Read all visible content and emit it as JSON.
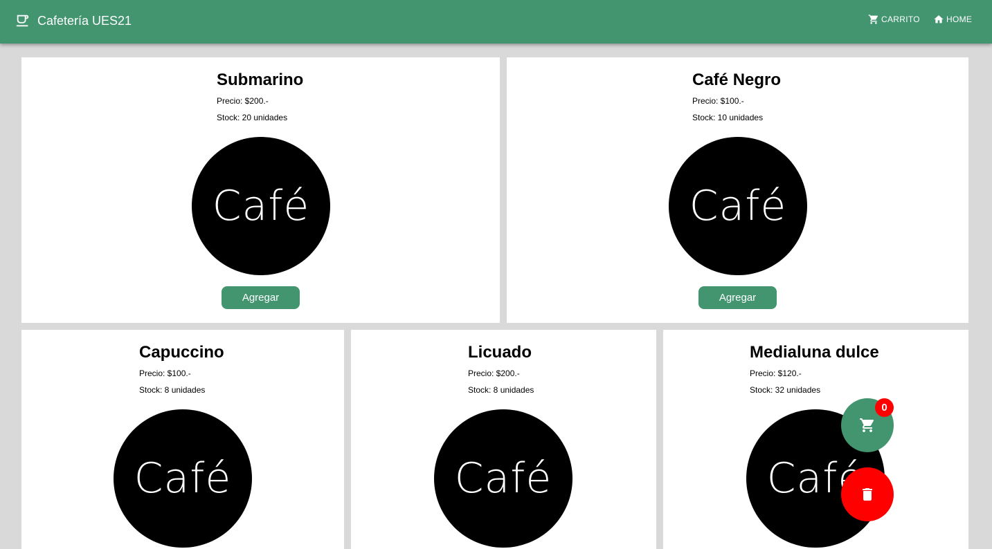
{
  "appbar": {
    "title": "Cafetería UES21",
    "brand_icon": "coffee-cup-icon",
    "nav": [
      {
        "label": "CARRITO",
        "icon": "cart-icon"
      },
      {
        "label": "HOME",
        "icon": "home-icon"
      }
    ]
  },
  "products": [
    {
      "name": "Submarino",
      "price": "Precio: $200.-",
      "stock": "Stock: 20 unidades",
      "image_text": "Café",
      "button": "Agregar"
    },
    {
      "name": "Café Negro",
      "price": "Precio: $100.-",
      "stock": "Stock: 10 unidades",
      "image_text": "Café",
      "button": "Agregar"
    },
    {
      "name": "Capuccino",
      "price": "Precio: $100.-",
      "stock": "Stock: 8 unidades",
      "image_text": "Café"
    },
    {
      "name": "Licuado",
      "price": "Precio: $200.-",
      "stock": "Stock: 8 unidades",
      "image_text": "Café"
    },
    {
      "name": "Medialuna dulce",
      "price": "Precio: $120.-",
      "stock": "Stock: 32 unidades",
      "image_text": "Café"
    }
  ],
  "cart_fab": {
    "count": "0",
    "icon": "cart-icon"
  },
  "trash_fab": {
    "icon": "trash-icon"
  },
  "colors": {
    "primary": "#42956f",
    "danger": "#ff0000",
    "background": "#d9d9d9"
  }
}
